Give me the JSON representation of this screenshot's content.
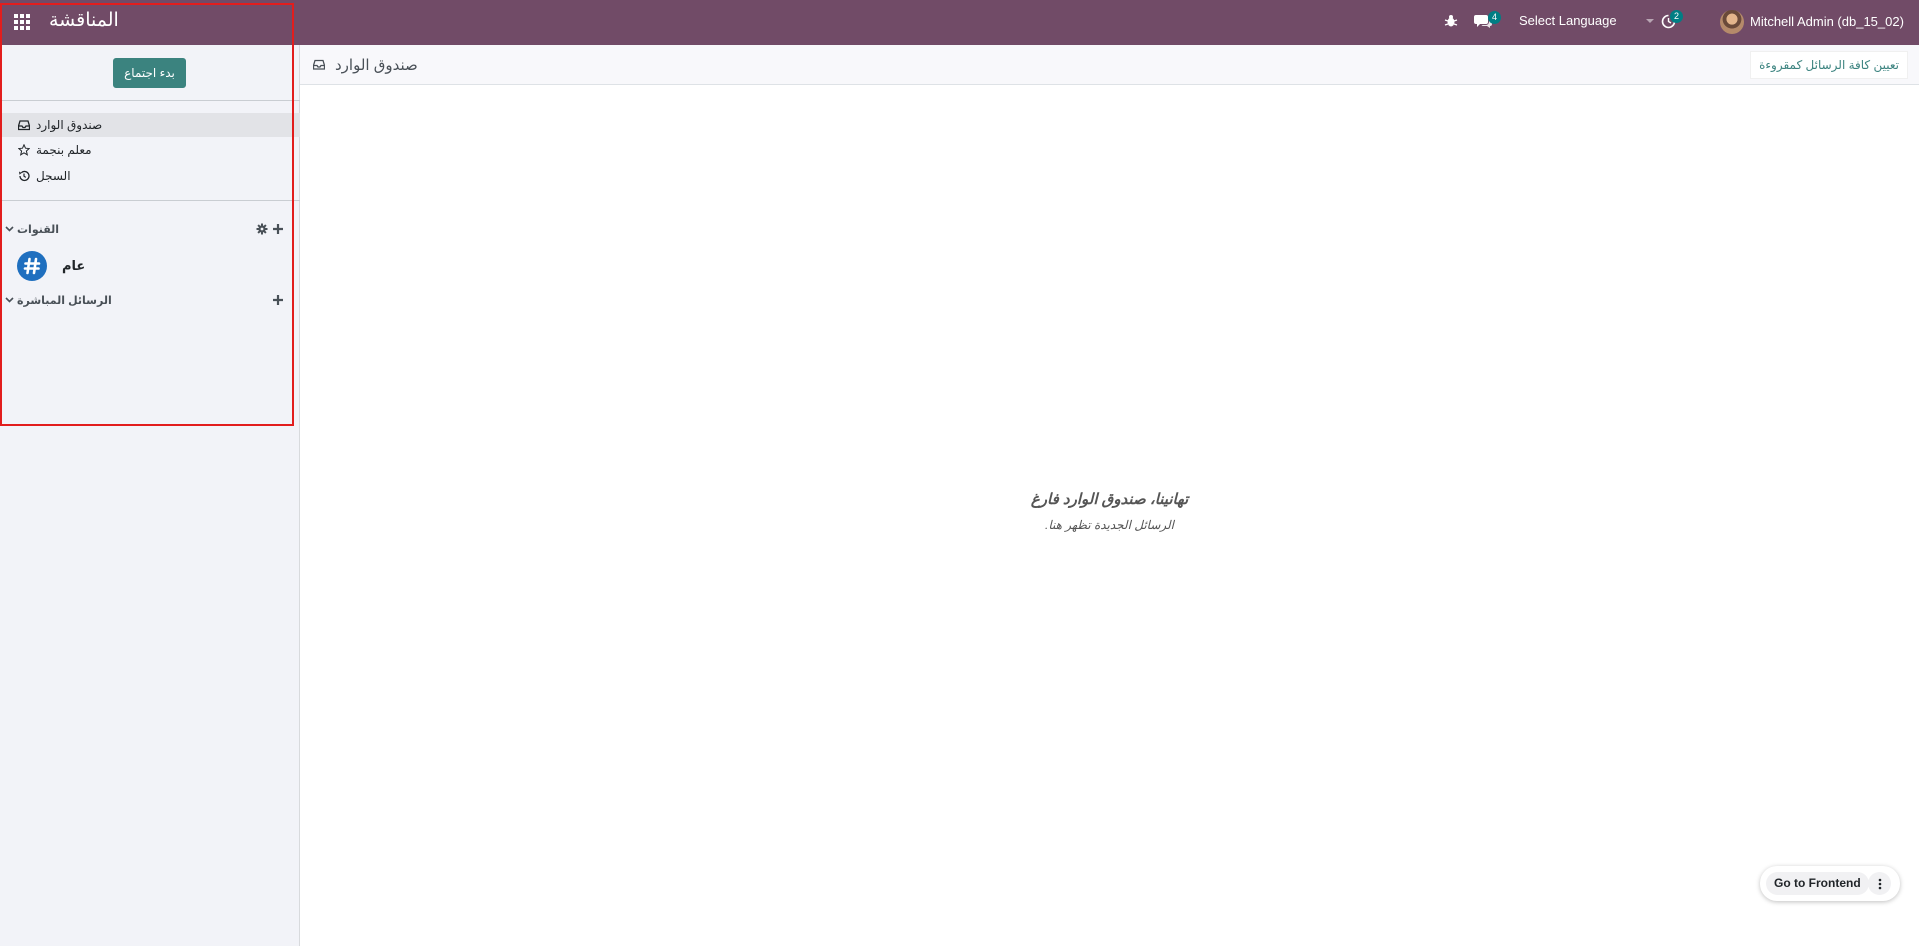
{
  "navbar": {
    "app_title": "المناقشة",
    "chat_badge": "4",
    "language_label": "Select Language",
    "activity_badge": "2",
    "user_name": "Mitchell Admin (db_15_02)"
  },
  "sidebar": {
    "start_meeting_label": "بدء اجتماع",
    "nav_items": [
      {
        "label": "صندوق الوارد",
        "icon": "inbox-icon"
      },
      {
        "label": "معلم بنجمة",
        "icon": "star-icon"
      },
      {
        "label": "السجل",
        "icon": "history-icon"
      }
    ],
    "channels_header": "القنوات",
    "channels": [
      {
        "name": "عام",
        "icon": "hashtag-icon"
      }
    ],
    "direct_messages_header": "الرسائل المباشرة"
  },
  "content": {
    "title": "صندوق الوارد",
    "mark_all_read_label": "تعيين كافة الرسائل كمقروءة",
    "empty_title": "تهانينا، صندوق الوارد فارغ",
    "empty_subtitle": "الرسائل الجديدة تظهر هنا."
  },
  "footer": {
    "go_to_frontend_label": "Go to Frontend"
  },
  "colors": {
    "navbar": "#714b67",
    "accent": "#3b837f",
    "badge": "#017e84",
    "highlight": "#e21d1d"
  }
}
